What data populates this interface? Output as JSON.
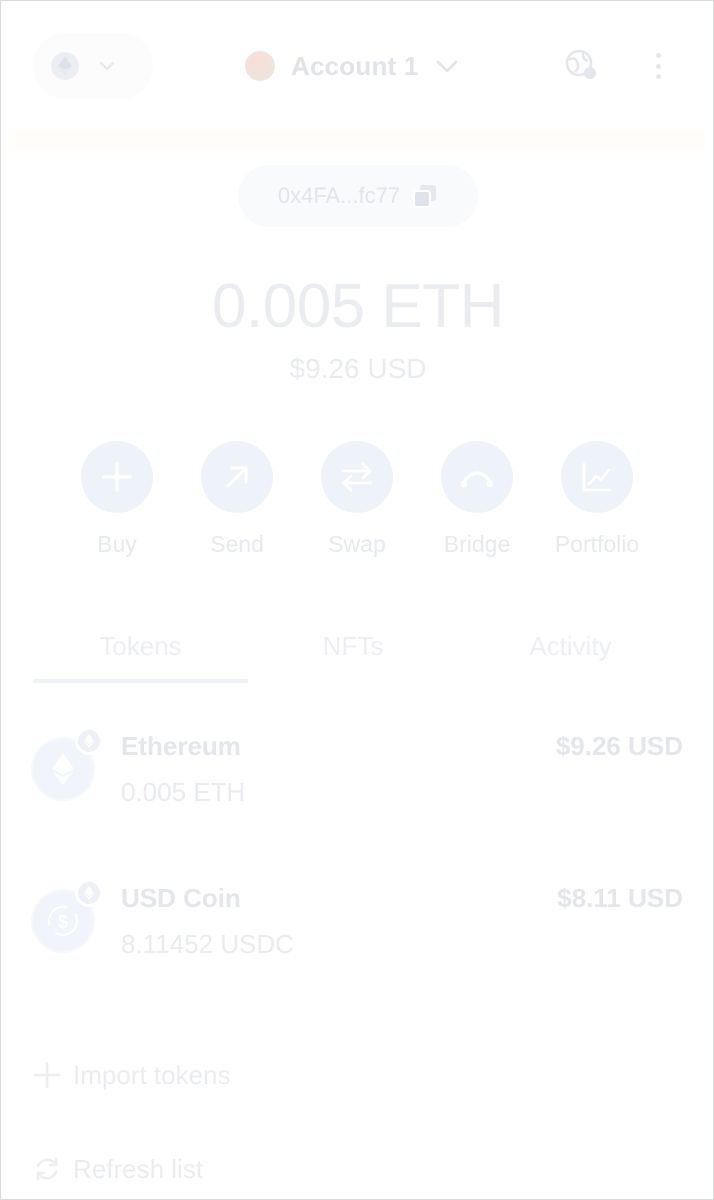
{
  "header": {
    "network_icon": "ethereum-icon",
    "account_name": "Account 1",
    "globe_icon": "globe-connection-icon",
    "menu_icon": "kebab-menu-icon"
  },
  "address": {
    "short": "0x4FA...fc77",
    "copy_icon": "copy-icon"
  },
  "balance": {
    "primary": "0.005 ETH",
    "secondary": "$9.26 USD"
  },
  "actions": [
    {
      "label": "Buy",
      "icon": "plus-icon"
    },
    {
      "label": "Send",
      "icon": "arrow-up-right-icon"
    },
    {
      "label": "Swap",
      "icon": "swap-arrows-icon"
    },
    {
      "label": "Bridge",
      "icon": "bridge-icon"
    },
    {
      "label": "Portfolio",
      "icon": "chart-icon"
    }
  ],
  "tabs": [
    {
      "label": "Tokens",
      "active": true
    },
    {
      "label": "NFTs",
      "active": false
    },
    {
      "label": "Activity",
      "active": false
    }
  ],
  "tokens": [
    {
      "name": "Ethereum",
      "amount": "0.005 ETH",
      "value": "$9.26 USD",
      "icon": "ethereum-icon",
      "badge": "ethereum-network-badge-icon"
    },
    {
      "name": "USD Coin",
      "amount": "8.11452 USDC",
      "value": "$8.11 USD",
      "icon": "usdc-icon",
      "badge": "ethereum-network-badge-icon"
    }
  ],
  "footer": {
    "import_label": "Import tokens",
    "refresh_label": "Refresh list"
  },
  "colors": {
    "accent_faded": "#eef2f9",
    "text_faded": "#e4e6eb"
  }
}
